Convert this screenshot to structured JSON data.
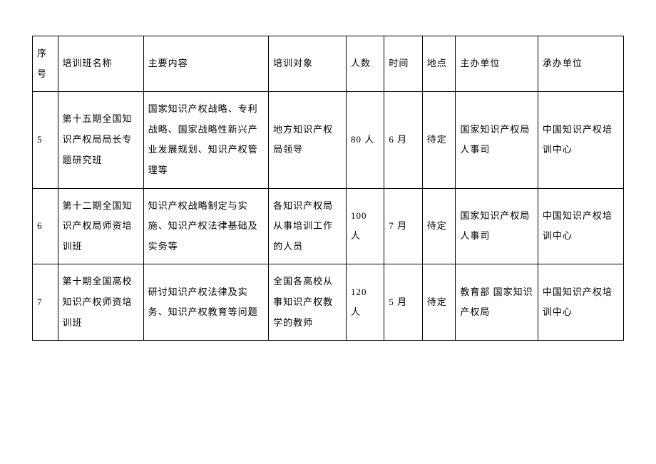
{
  "headers": {
    "seq": "序号",
    "name": "培训班名称",
    "content": "主要内容",
    "object": "培训对象",
    "number": "人数",
    "time": "时间",
    "location": "地点",
    "organizer": "主办单位",
    "host": "承办单位"
  },
  "rows": [
    {
      "seq": "5",
      "name": "第十五期全国知识产权局局长专题研究班",
      "content": "国家知识产权战略、专利战略、国家战略性新兴产业发展规划、知识产权管理等",
      "object": "地方知识产权局领导",
      "number": "80 人",
      "time": "6 月",
      "location": "待定",
      "organizer": "国家知识产权局人事司",
      "host": "中国知识产权培训中心"
    },
    {
      "seq": "6",
      "name": "第十二期全国知识产权局师资培训班",
      "content": "知识产权战略制定与实施、知识产权法律基础及实务等",
      "object": "各知识产权局从事培训工作的人员",
      "number": "100 人",
      "time": "7 月",
      "location": "待定",
      "organizer": "国家知识产权局人事司",
      "host": "中国知识产权培训中心"
    },
    {
      "seq": "7",
      "name": "第十期全国高校知识产权师资培训班",
      "content": "研讨知识产权法律及实务、知识产权教育等问题",
      "object": "全国各高校从事知识产权教学的教师",
      "number": "120 人",
      "time": "5 月",
      "location": "待定",
      "organizer": "教育部\n国家知识产权局",
      "host": "中国知识产权培训中心"
    }
  ]
}
